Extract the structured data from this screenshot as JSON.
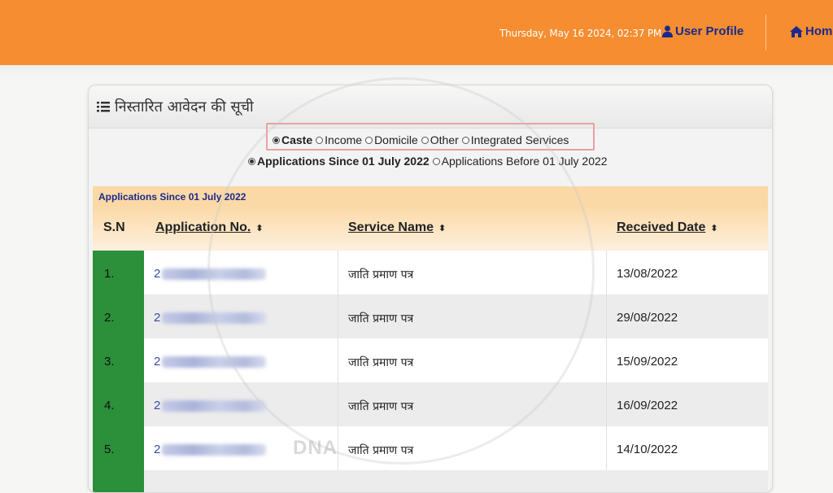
{
  "header": {
    "datetime": "Thursday, May 16 2024, 02:37 PM",
    "user_profile_label": "User Profile",
    "home_label": "Home"
  },
  "card": {
    "title": "निस्तारित आवेदन की सूची"
  },
  "filters": {
    "service_types": [
      {
        "label": "Caste",
        "selected": true
      },
      {
        "label": "Income",
        "selected": false
      },
      {
        "label": "Domicile",
        "selected": false
      },
      {
        "label": "Other",
        "selected": false
      },
      {
        "label": "Integrated Services",
        "selected": false
      }
    ],
    "periods": [
      {
        "label": "Applications Since 01 July 2022",
        "selected": true
      },
      {
        "label": "Applications Before 01 July 2022",
        "selected": false
      }
    ]
  },
  "table": {
    "caption": "Applications Since 01 July 2022",
    "headers": {
      "sn": "S.N",
      "application_no": "Application No.",
      "service_name": "Service Name",
      "received_date": "Received Date"
    },
    "sort_glyph": "⬍",
    "rows": [
      {
        "sn": "1.",
        "app_prefix": "2",
        "service": "जाति प्रमाण पत्र",
        "date": "13/08/2022"
      },
      {
        "sn": "2.",
        "app_prefix": "2",
        "service": "जाति प्रमाण पत्र",
        "date": "29/08/2022"
      },
      {
        "sn": "3.",
        "app_prefix": "2",
        "service": "जाति प्रमाण पत्र",
        "date": "15/09/2022"
      },
      {
        "sn": "4.",
        "app_prefix": "2",
        "service": "जाति प्रमाण पत्र",
        "date": "16/09/2022"
      },
      {
        "sn": "5.",
        "app_prefix": "2",
        "service": "जाति प्रमाण पत्र",
        "date": "14/10/2022"
      }
    ]
  },
  "colors": {
    "topbar": "#f68d30",
    "sn_cell": "#2c8f3a",
    "header_band": "#fbd9a6",
    "link_text": "#1b2a8a"
  },
  "watermark_text": "DNA"
}
